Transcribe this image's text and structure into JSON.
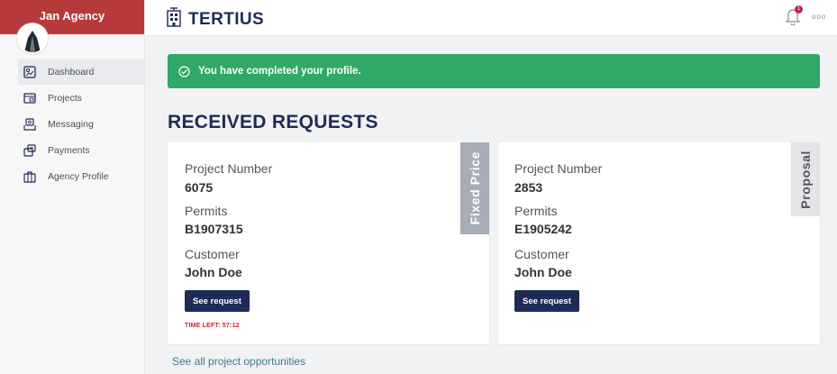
{
  "sidebar": {
    "agency_name": "Jan Agency",
    "nav": [
      {
        "label": "Dashboard",
        "icon": "dashboard-icon",
        "active": true
      },
      {
        "label": "Projects",
        "icon": "projects-icon",
        "active": false
      },
      {
        "label": "Messaging",
        "icon": "messaging-icon",
        "active": false
      },
      {
        "label": "Payments",
        "icon": "payments-icon",
        "active": false
      },
      {
        "label": "Agency Profile",
        "icon": "agency-profile-icon",
        "active": false
      }
    ]
  },
  "topbar": {
    "brand": "TERTIUS",
    "notification_count": "1",
    "more_label": "ooo"
  },
  "banner": {
    "message": "You have completed your profile.",
    "color": "#30a867"
  },
  "main": {
    "section_title": "RECEIVED REQUESTS",
    "cards": [
      {
        "tag": "Fixed Price",
        "project_label": "Project Number",
        "project_value": "6075",
        "permits_label": "Permits",
        "permits_value": "B1907315",
        "customer_label": "Customer",
        "customer_value": "John Doe",
        "button_label": "See request",
        "time_left": "TIME LEFT: 57:12"
      },
      {
        "tag": "Proposal",
        "project_label": "Project Number",
        "project_value": "2853",
        "permits_label": "Permits",
        "permits_value": "E1905242",
        "customer_label": "Customer",
        "customer_value": "John Doe",
        "button_label": "See request"
      }
    ],
    "see_all_link": "See all project opportunities"
  },
  "colors": {
    "agency_red": "#b63a3a",
    "navy": "#1f2b57",
    "success_green": "#30a867",
    "alert_red": "#d11a2a"
  }
}
